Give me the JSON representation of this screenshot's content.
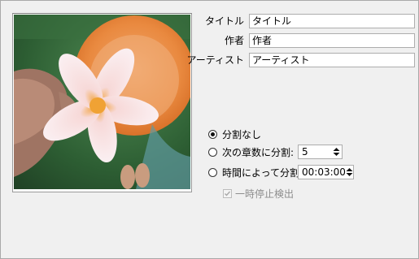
{
  "metadata": {
    "title_label": "タイトル",
    "title_value": "タイトル",
    "author_label": "作者",
    "author_value": "作者",
    "artist_label": "アーティスト",
    "artist_value": "アーティスト"
  },
  "split": {
    "none_label": "分割なし",
    "none_selected": true,
    "chapters_label": "次の章数に分割:",
    "chapters_value": "5",
    "time_label": "時間によって分割:",
    "time_value": "00:03:00",
    "pause_detect_label": "一時停止検出",
    "pause_detect_checked": true,
    "pause_detect_enabled": false
  },
  "artwork": {
    "subject": "plumeria-flower-in-hand"
  }
}
